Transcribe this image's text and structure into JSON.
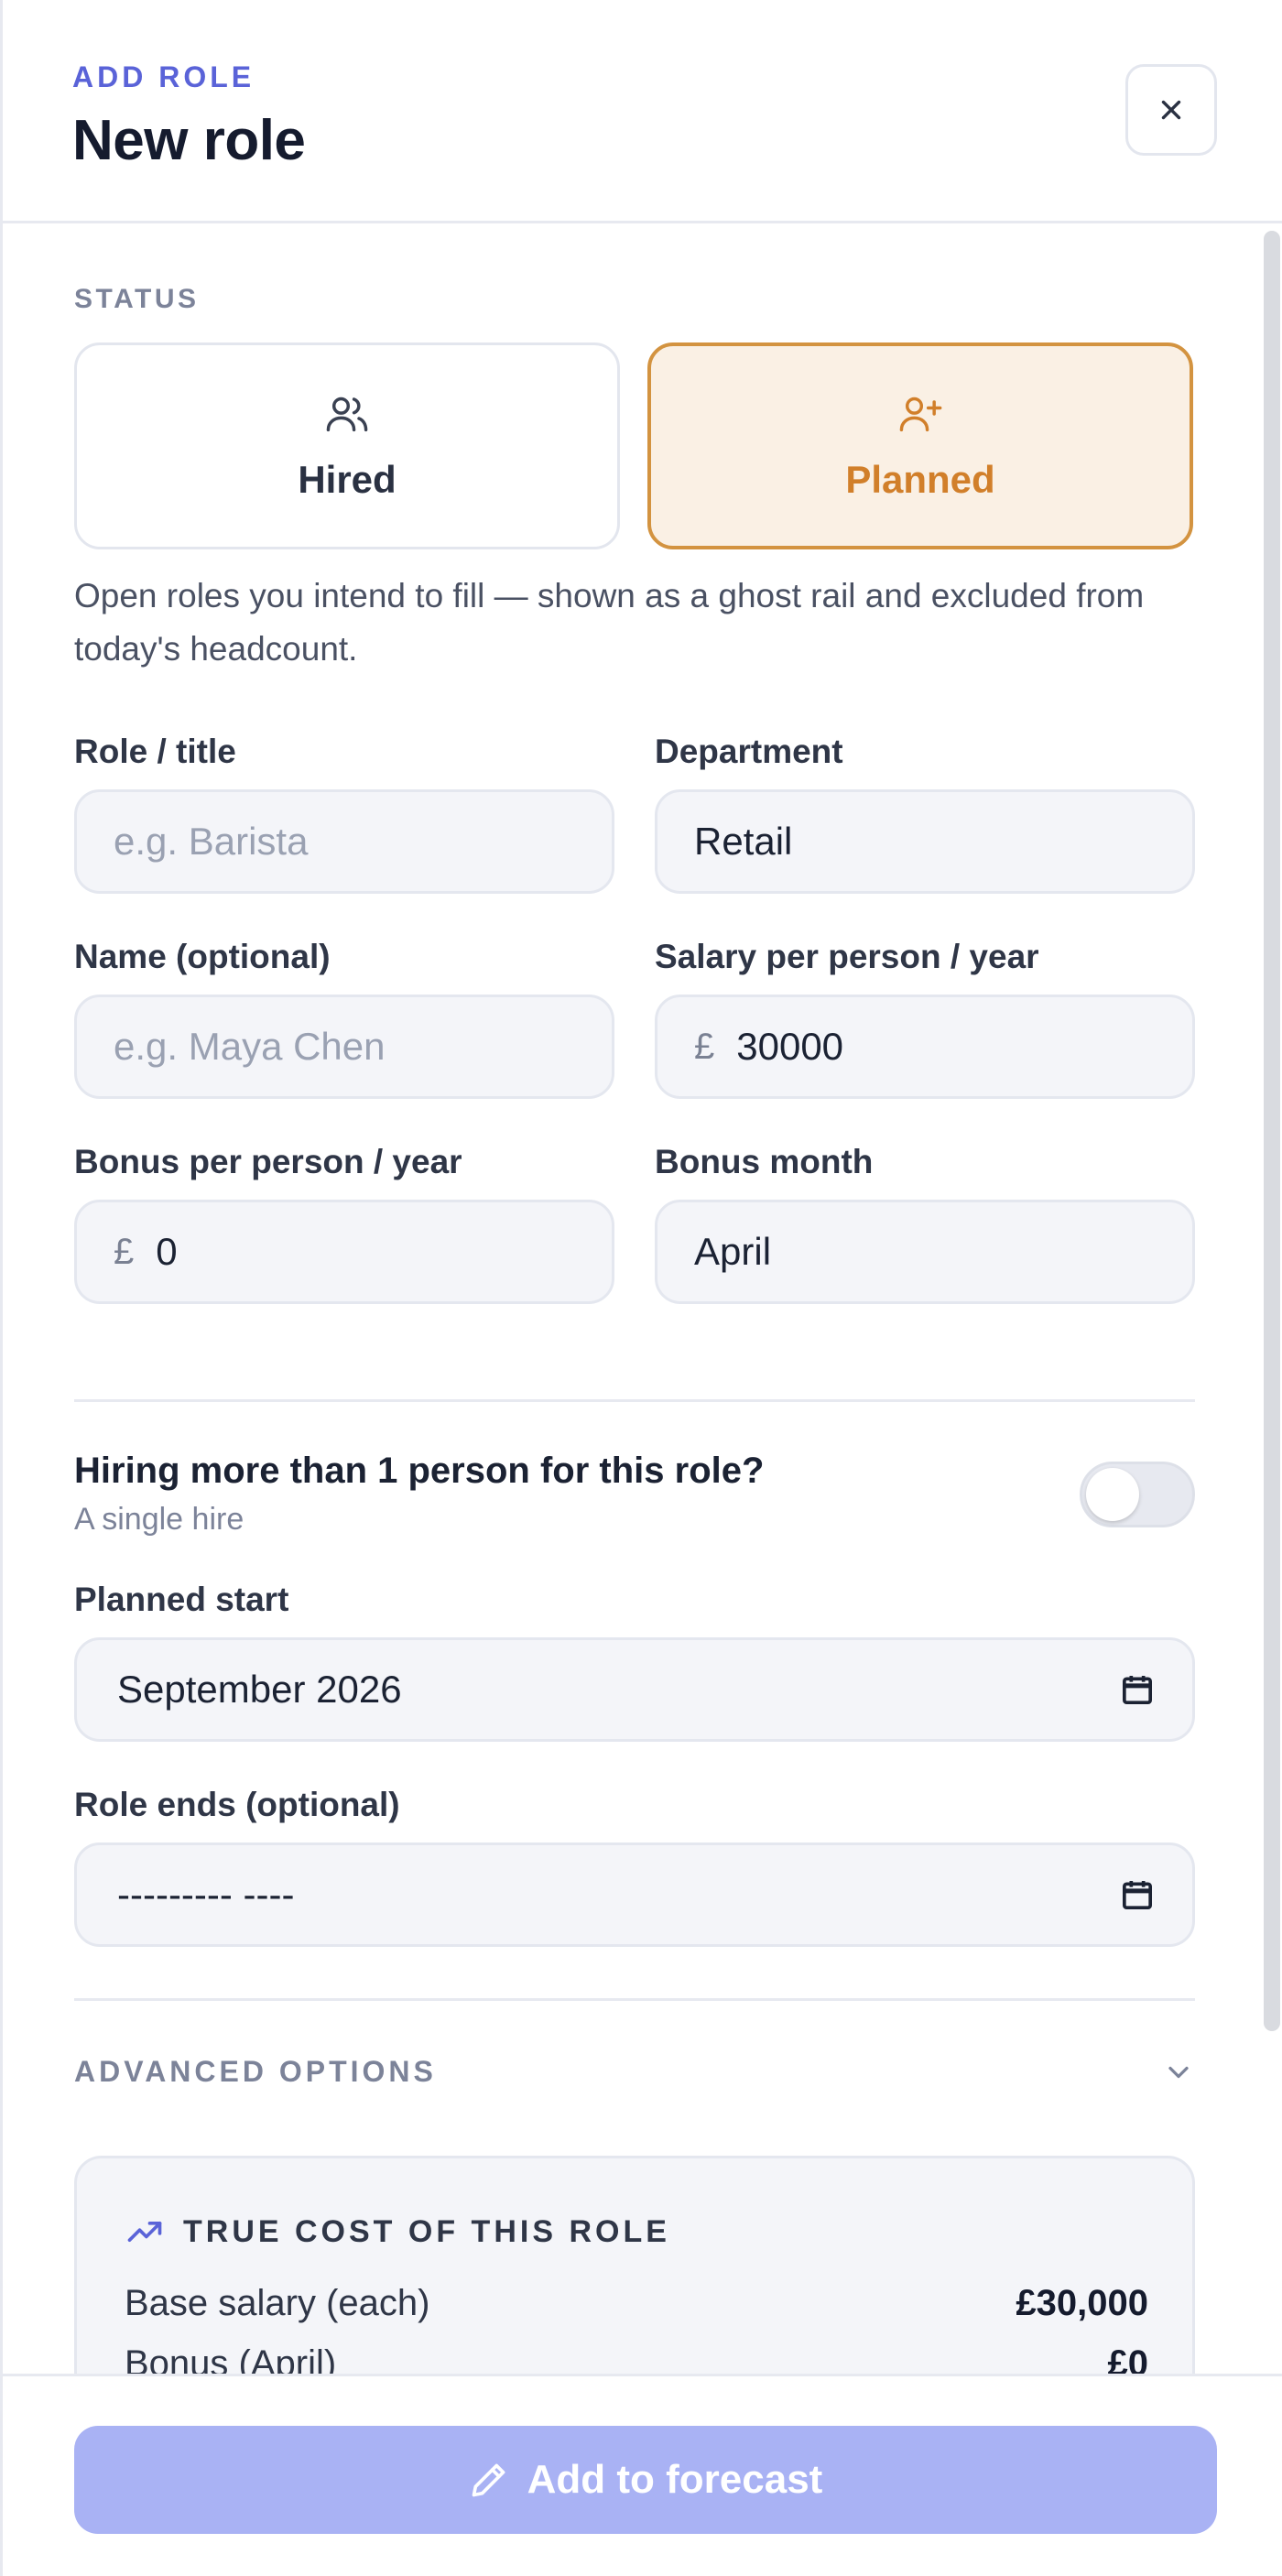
{
  "header": {
    "eyebrow": "ADD ROLE",
    "title": "New role"
  },
  "status": {
    "label": "STATUS",
    "options": [
      {
        "label": "Hired",
        "icon": "users-icon",
        "selected": false
      },
      {
        "label": "Planned",
        "icon": "user-plus-icon",
        "selected": true
      }
    ],
    "help": "Open roles you intend to fill — shown as a ghost rail and excluded from today's headcount."
  },
  "form": {
    "role_title": {
      "label": "Role / title",
      "placeholder": "e.g. Barista",
      "value": ""
    },
    "department": {
      "label": "Department",
      "value": "Retail"
    },
    "name": {
      "label": "Name (optional)",
      "placeholder": "e.g. Maya Chen",
      "value": ""
    },
    "salary": {
      "label": "Salary per person / year",
      "currency": "£",
      "value": "30000"
    },
    "bonus": {
      "label": "Bonus per person / year",
      "currency": "£",
      "value": "0"
    },
    "bonus_month": {
      "label": "Bonus month",
      "value": "April"
    }
  },
  "multi_hire": {
    "question": "Hiring more than 1 person for this role?",
    "subtext": "A single hire",
    "enabled": false
  },
  "planned_start": {
    "label": "Planned start",
    "value": "September 2026"
  },
  "role_ends": {
    "label": "Role ends (optional)",
    "value": "--------- ----"
  },
  "advanced": {
    "label": "ADVANCED OPTIONS"
  },
  "cost": {
    "title": "TRUE COST OF THIS ROLE",
    "rows": [
      {
        "label": "Base salary (each)",
        "value": "£30,000"
      },
      {
        "label": "Bonus (April)",
        "value": "£0"
      }
    ]
  },
  "footer": {
    "submit_label": "Add to forecast"
  },
  "colors": {
    "accent": "#5a63d8",
    "planned": "#d17f2a",
    "planned_bg": "#faf0e4",
    "button": "#a9b2f4"
  }
}
